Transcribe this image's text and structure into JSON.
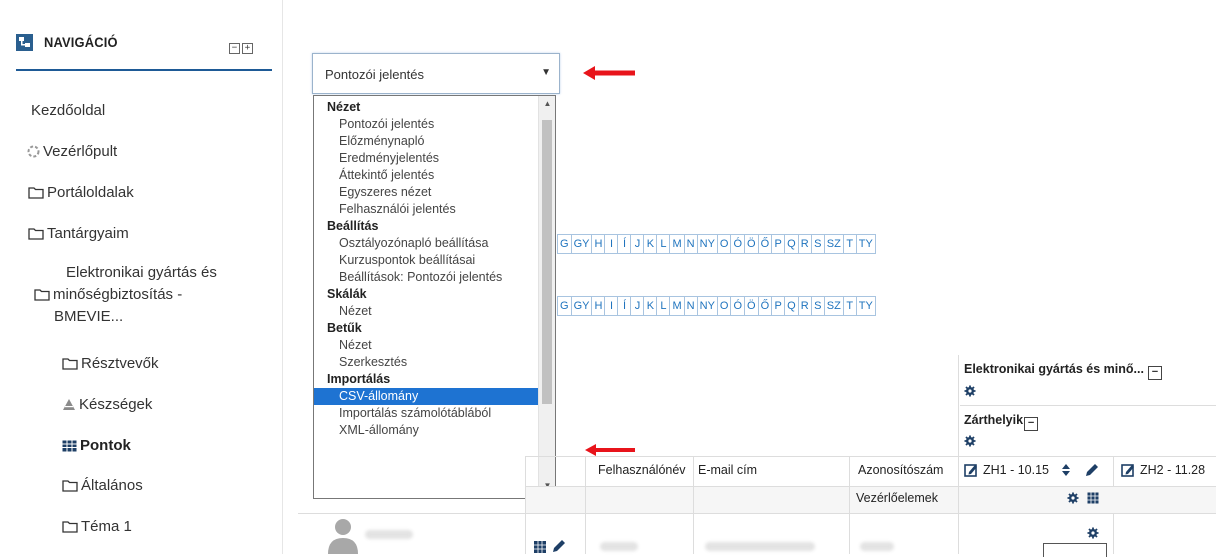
{
  "sidebar": {
    "title": "NAVIGÁCIÓ",
    "toggle_collapse": "−",
    "toggle_expand": "+",
    "items": {
      "home": "Kezdőoldal",
      "dashboard": "Vezérlőpult",
      "site_pages": "Portáloldalak",
      "my_courses": "Tantárgyaim",
      "course_line1": "Elektronikai gyártás és",
      "course_line2": "minőségbiztosítás -",
      "course_line3": "BMEVIE...",
      "participants": "Résztvevők",
      "competencies": "Készségek",
      "grades": "Pontok",
      "general": "Általános",
      "topic1": "Téma 1"
    }
  },
  "report_select": {
    "value": "Pontozói jelentés",
    "caret": "▼"
  },
  "dropdown": {
    "scroll_up": "▲",
    "scroll_down": "▼",
    "groups": [
      {
        "label": "Nézet",
        "options": [
          "Pontozói jelentés",
          "Előzménynapló",
          "Eredményjelentés",
          "Áttekintő jelentés",
          "Egyszeres nézet",
          "Felhasználói jelentés"
        ]
      },
      {
        "label": "Beállítás",
        "options": [
          "Osztályozónapló beállítása",
          "Kurzuspontok beállításai",
          "Beállítások: Pontozói jelentés"
        ]
      },
      {
        "label": "Skálák",
        "options": [
          "Nézet"
        ]
      },
      {
        "label": "Betűk",
        "options": [
          "Nézet",
          "Szerkesztés"
        ]
      },
      {
        "label": "Importálás",
        "options": [
          "CSV-állomány",
          "Importálás számolótáblából",
          "XML-állomány"
        ]
      }
    ],
    "selected": "CSV-állomány"
  },
  "initials_row": [
    "G",
    "GY",
    "H",
    "I",
    "Í",
    "J",
    "K",
    "L",
    "M",
    "N",
    "NY",
    "O",
    "Ó",
    "Ö",
    "Ő",
    "P",
    "Q",
    "R",
    "S",
    "SZ",
    "T",
    "TY"
  ],
  "grade_table": {
    "category_title": "Elektronikai gyártás és minő...",
    "subcategory_title": "Zárthelyik",
    "collapse_symbol": "−",
    "col_username": "Felhasználónév",
    "col_email": "E-mail cím",
    "col_idnumber": "Azonosítószám",
    "col_zh1": "ZH1 - 10.15",
    "col_zh2": "ZH2 - 11.28",
    "controls_label": "Vezérlőelemek"
  },
  "colors": {
    "accent": "#1e5a96",
    "selected_option": "#1e73d2",
    "annotation_arrow": "#e8141b",
    "link": "#1e73be"
  }
}
